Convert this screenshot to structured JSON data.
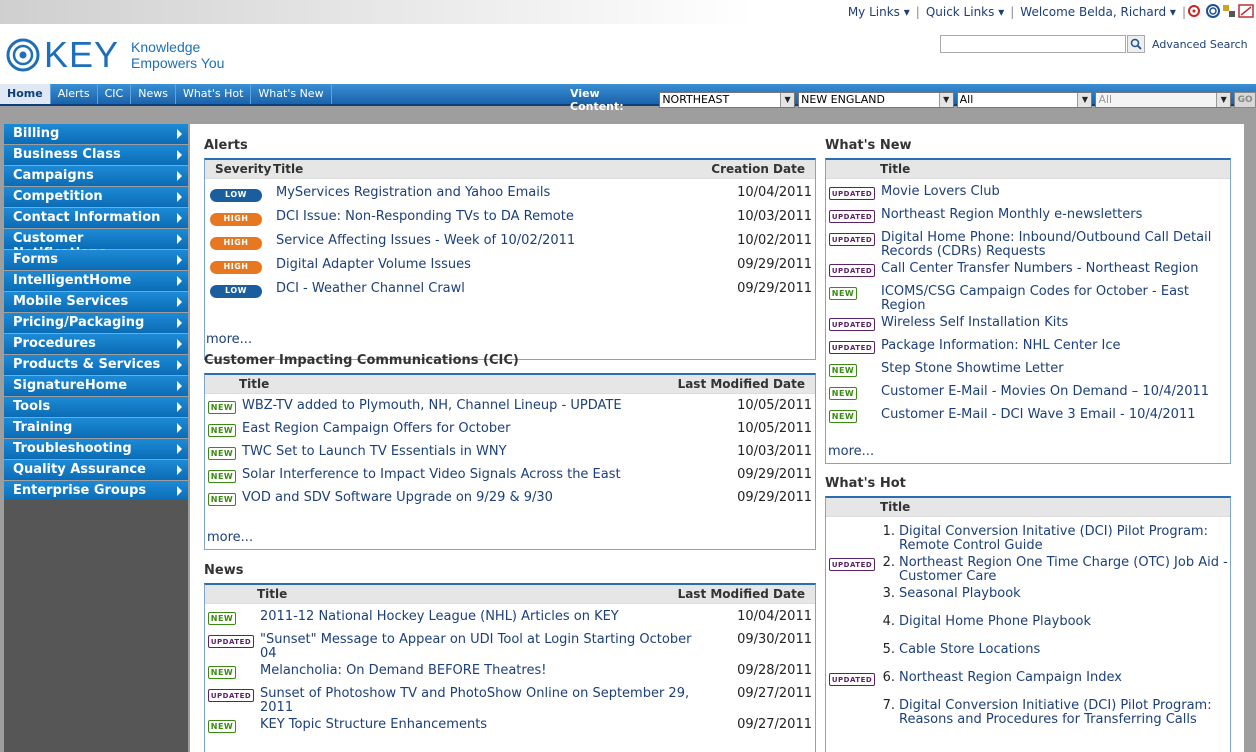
{
  "topbar": {
    "my_links": "My Links ▾",
    "quick_links": "Quick Links ▾",
    "welcome": "Welcome Belda, Richard ▾"
  },
  "header": {
    "logo_text": "KEY",
    "tagline_line1": "Knowledge",
    "tagline_line2": "Empowers You",
    "search_placeholder": "",
    "advanced_search": "Advanced Search"
  },
  "nav": {
    "tabs": [
      "Home",
      "Alerts",
      "CIC",
      "News",
      "What's Hot",
      "What's New"
    ],
    "view_content_label": "View Content:",
    "selects": [
      "NORTHEAST",
      "NEW ENGLAND",
      "All",
      "All"
    ],
    "go_label": "GO"
  },
  "sidebar": {
    "items": [
      "Billing",
      "Business Class",
      "Campaigns",
      "Competition",
      "Contact Information",
      "Customer Notifications",
      "Forms",
      "IntelligentHome",
      "Mobile Services",
      "Pricing/Packaging",
      "Procedures",
      "Products & Services",
      "SignatureHome",
      "Tools",
      "Training",
      "Troubleshooting",
      "Quality Assurance",
      "Enterprise Groups"
    ]
  },
  "alerts": {
    "title": "Alerts",
    "col_severity": "Severity",
    "col_title": "Title",
    "col_date": "Creation Date",
    "rows": [
      {
        "severity": "LOW",
        "title": "MyServices Registration and Yahoo Emails",
        "date": "10/04/2011"
      },
      {
        "severity": "HIGH",
        "title": "DCI Issue: Non-Responding TVs to DA Remote",
        "date": "10/03/2011"
      },
      {
        "severity": "HIGH",
        "title": "Service Affecting Issues - Week of 10/02/2011",
        "date": "10/02/2011"
      },
      {
        "severity": "HIGH",
        "title": "Digital Adapter Volume Issues",
        "date": "09/29/2011"
      },
      {
        "severity": "LOW",
        "title": "DCI - Weather Channel Crawl",
        "date": "09/29/2011"
      }
    ],
    "more": "more..."
  },
  "cic": {
    "title": "Customer Impacting Communications (CIC)",
    "col_title": "Title",
    "col_date": "Last Modified Date",
    "rows": [
      {
        "badge": "NEW",
        "title": "WBZ-TV added to Plymouth, NH, Channel Lineup - UPDATE",
        "date": "10/05/2011"
      },
      {
        "badge": "NEW",
        "title": "East Region Campaign Offers for October",
        "date": "10/05/2011"
      },
      {
        "badge": "NEW",
        "title": "TWC Set to Launch TV Essentials in WNY",
        "date": "10/03/2011"
      },
      {
        "badge": "NEW",
        "title": "Solar Interference to Impact Video Signals Across the East",
        "date": "09/29/2011"
      },
      {
        "badge": "NEW",
        "title": "VOD and SDV Software Upgrade on 9/29 & 9/30",
        "date": "09/29/2011"
      }
    ],
    "more": "more..."
  },
  "news": {
    "title": "News",
    "col_title": "Title",
    "col_date": "Last Modified Date",
    "rows": [
      {
        "badge": "NEW",
        "title": "2011-12 National Hockey League (NHL) Articles on KEY",
        "date": "10/04/2011"
      },
      {
        "badge": "UPDATED",
        "title": "\"Sunset\" Message to Appear on UDI Tool at Login Starting October 04",
        "date": "09/30/2011"
      },
      {
        "badge": "NEW",
        "title": "Melancholia: On Demand BEFORE Theatres!",
        "date": "09/28/2011"
      },
      {
        "badge": "UPDATED",
        "title": "Sunset of Photoshow TV and PhotoShow Online on September 29, 2011",
        "date": "09/27/2011"
      },
      {
        "badge": "NEW",
        "title": "KEY Topic Structure Enhancements",
        "date": "09/27/2011"
      }
    ]
  },
  "whats_new": {
    "title": "What's New",
    "col_title": "Title",
    "rows": [
      {
        "badge": "UPDATED",
        "title": "Movie Lovers Club"
      },
      {
        "badge": "UPDATED",
        "title": "Northeast Region Monthly e-newsletters"
      },
      {
        "badge": "UPDATED",
        "title": "Digital Home Phone: Inbound/Outbound Call Detail Records (CDRs) Requests"
      },
      {
        "badge": "UPDATED",
        "title": "Call Center Transfer Numbers - Northeast Region"
      },
      {
        "badge": "NEW",
        "title": "ICOMS/CSG Campaign Codes for October - East Region"
      },
      {
        "badge": "UPDATED",
        "title": "Wireless Self Installation Kits"
      },
      {
        "badge": "UPDATED",
        "title": "Package Information: NHL Center Ice"
      },
      {
        "badge": "NEW",
        "title": "Step Stone Showtime Letter"
      },
      {
        "badge": "NEW",
        "title": "Customer E-Mail - Movies On Demand – 10/4/2011"
      },
      {
        "badge": "NEW",
        "title": "Customer E-Mail - DCI Wave 3 Email - 10/4/2011"
      }
    ],
    "more": "more..."
  },
  "whats_hot": {
    "title": "What's Hot",
    "col_title": "Title",
    "rows": [
      {
        "badge": "",
        "num": "1.",
        "title": "Digital Conversion Initative (DCI) Pilot Program: Remote Control Guide"
      },
      {
        "badge": "UPDATED",
        "num": "2.",
        "title": "Northeast Region One Time Charge (OTC) Job Aid - Customer Care"
      },
      {
        "badge": "",
        "num": "3.",
        "title": "Seasonal Playbook"
      },
      {
        "badge": "",
        "num": "4.",
        "title": "Digital Home Phone Playbook"
      },
      {
        "badge": "",
        "num": "5.",
        "title": "Cable Store Locations"
      },
      {
        "badge": "UPDATED",
        "num": "6.",
        "title": "Northeast Region Campaign Index"
      },
      {
        "badge": "",
        "num": "7.",
        "title": "Digital Conversion Initiative (DCI) Pilot Program: Reasons and Procedures for Transferring Calls"
      }
    ]
  }
}
